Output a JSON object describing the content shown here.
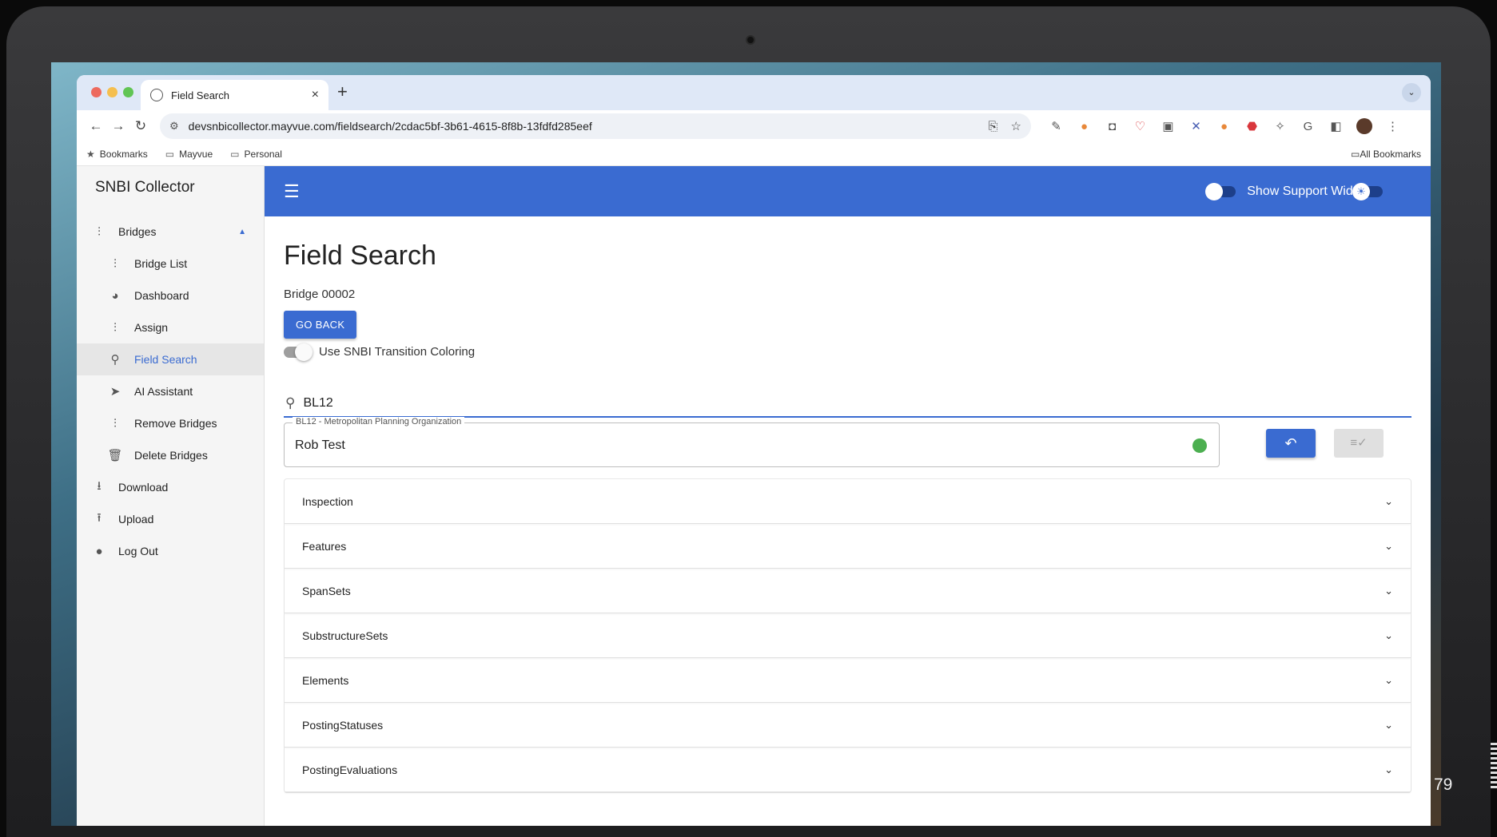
{
  "browser": {
    "tab_title": "Field Search",
    "tab_close": "×",
    "new_tab": "+",
    "tab_menu": "⌄",
    "url": "devsnbicollector.mayvue.com/fieldsearch/2cdac5bf-3b61-4615-8f8b-13fdfd285eef",
    "bookmarks": [
      {
        "label": "Bookmarks",
        "icon": "star-icon"
      },
      {
        "label": "Mayvue",
        "icon": "folder-icon"
      },
      {
        "label": "Personal",
        "icon": "folder-icon"
      }
    ],
    "all_bookmarks": "All Bookmarks"
  },
  "sidebar": {
    "title": "SNBI Collector",
    "items": [
      {
        "label": "Bridges",
        "icon": "bridges-icon"
      },
      {
        "label": "Bridge List",
        "icon": "bridge-list-icon"
      },
      {
        "label": "Dashboard",
        "icon": "pie-chart-icon"
      },
      {
        "label": "Assign",
        "icon": "assign-icon"
      },
      {
        "label": "Field Search",
        "icon": "search-icon"
      },
      {
        "label": "AI Assistant",
        "icon": "send-icon"
      },
      {
        "label": "Remove Bridges",
        "icon": "remove-icon"
      },
      {
        "label": "Delete Bridges",
        "icon": "trash-icon"
      },
      {
        "label": "Download",
        "icon": "download-icon"
      },
      {
        "label": "Upload",
        "icon": "upload-icon"
      },
      {
        "label": "Log Out",
        "icon": "person-icon"
      }
    ]
  },
  "appbar": {
    "support_label": "Show Support Widget"
  },
  "main": {
    "title": "Field Search",
    "bridge_label": "Bridge 00002",
    "go_back_label": "GO BACK",
    "coloring_label": "Use SNBI Transition Coloring",
    "search_value": "BL12",
    "field": {
      "legend": "BL12 - Metropolitan Planning Organization",
      "value": "Rob Test",
      "status_color": "#4caf50"
    },
    "sections": [
      "Inspection",
      "Features",
      "SpanSets",
      "SubstructureSets",
      "Elements",
      "PostingStatuses",
      "PostingEvaluations"
    ]
  },
  "slide_number": "79",
  "colors": {
    "accent": "#3a6bd1",
    "status_ok": "#4caf50"
  }
}
